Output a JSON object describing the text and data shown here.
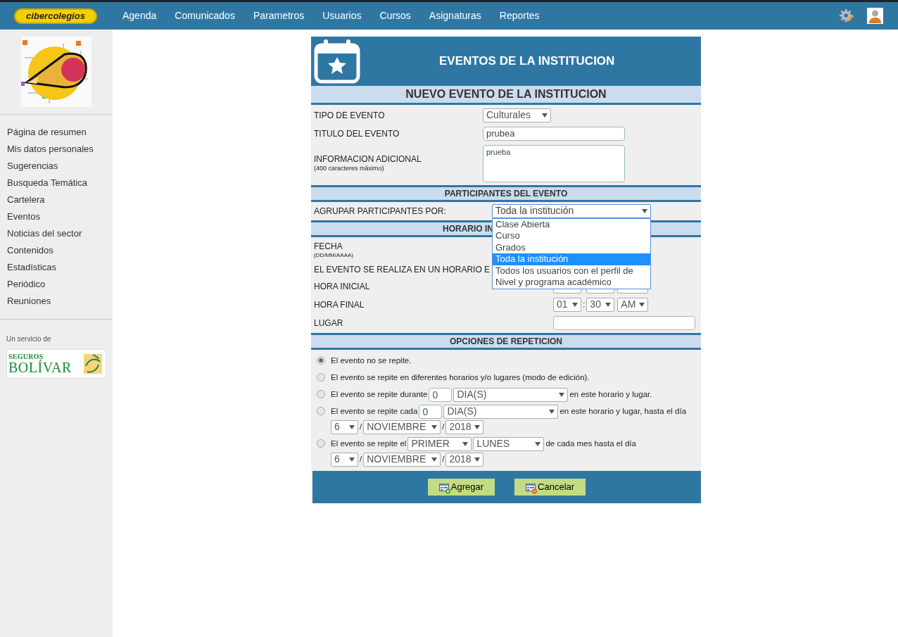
{
  "nav": {
    "logo": "cibercolegios",
    "items": [
      "Agenda",
      "Comunicados",
      "Parametros",
      "Usuarios",
      "Cursos",
      "Asignaturas",
      "Reportes"
    ]
  },
  "sidebar": {
    "items": [
      "Página de resumen",
      "Mis datos personales",
      "Sugerencias",
      "Busqueda Temática",
      "Cartelera",
      "Eventos",
      "Noticias del sector",
      "Contenidos",
      "Estadísticas",
      "Periódico",
      "Reuniones"
    ],
    "service_label": "Un servicio de",
    "sponsor": {
      "line1": "SEGUROS",
      "line2": "BOLÍVAR"
    }
  },
  "panel": {
    "title": "EVENTOS DE LA INSTITUCION",
    "form_title": "NUEVO EVENTO DE LA INSTITUCION",
    "fields": [
      {
        "kind": "select",
        "label": "TIPO DE EVENTO",
        "value": "Culturales"
      },
      {
        "kind": "text",
        "label": "TITULO DEL EVENTO",
        "value": "prubea"
      },
      {
        "kind": "textarea",
        "label": "INFORMACION ADICIONAL",
        "note": "(400 caracteres máximo)",
        "value": "prueba"
      }
    ]
  },
  "participants": {
    "title": "PARTICIPANTES DEL EVENTO",
    "label": "AGRUPAR PARTICIPANTES POR:",
    "select": {
      "value": "Toda la institución",
      "expanded": true,
      "options": [
        {
          "label": "Clase Abierta",
          "selected": false
        },
        {
          "label": "Curso",
          "selected": false
        },
        {
          "label": "Grados",
          "selected": false
        },
        {
          "label": "Toda la institución",
          "selected": true
        },
        {
          "label": "Todos los usuarios con el perfil de",
          "selected": false
        },
        {
          "label": "Nivel y programa académico",
          "selected": false
        }
      ]
    }
  },
  "schedule": {
    "title": "HORARIO IN",
    "rows": [
      {
        "kind": "date",
        "label": "FECHA",
        "note": "(DD/MM/AAAA)"
      },
      {
        "kind": "plain",
        "label": "EL EVENTO SE REALIZA EN UN HORARIO E"
      },
      {
        "kind": "time",
        "label": "HORA INICIAL"
      },
      {
        "kind": "time",
        "label": "HORA FINAL",
        "hour": "01",
        "separator": ":",
        "minute": "30",
        "period": "AM"
      },
      {
        "kind": "input",
        "label": "LUGAR"
      }
    ]
  },
  "repetition": {
    "title": "OPCIONES DE REPETICION",
    "options": [
      {
        "selected": true,
        "parts": [
          {
            "kind": "text",
            "text": "El evento no se repite."
          }
        ]
      },
      {
        "selected": false,
        "parts": [
          {
            "kind": "text",
            "text": "El evento se repite en diferentes horarios y/o lugares (modo de edición)."
          }
        ]
      },
      {
        "selected": false,
        "parts": [
          {
            "kind": "text",
            "text": "El evento se repite durante"
          },
          {
            "kind": "input",
            "value": "0"
          },
          {
            "kind": "unit",
            "value": "DIA(S)"
          },
          {
            "kind": "text",
            "text": "en este horario y lugar."
          }
        ]
      },
      {
        "selected": false,
        "parts": [
          {
            "kind": "text",
            "text": "El evento se repite cada"
          },
          {
            "kind": "input",
            "value": "0"
          },
          {
            "kind": "unit",
            "value": "DIA(S)"
          },
          {
            "kind": "text",
            "text": "en este horario y lugar, hasta el día"
          },
          {
            "kind": "break"
          },
          {
            "kind": "day",
            "value": "6"
          },
          {
            "kind": "sep",
            "text": "/"
          },
          {
            "kind": "month",
            "value": "NOVIEMBRE"
          },
          {
            "kind": "sep",
            "text": "/"
          },
          {
            "kind": "year",
            "value": "2018"
          }
        ]
      },
      {
        "selected": false,
        "parts": [
          {
            "kind": "text",
            "text": "El evento se repite el"
          },
          {
            "kind": "ordinal",
            "value": "PRIMER"
          },
          {
            "kind": "weekday",
            "value": "LUNES"
          },
          {
            "kind": "text",
            "text": "de cada mes hasta el día"
          },
          {
            "kind": "break"
          },
          {
            "kind": "day",
            "value": "6"
          },
          {
            "kind": "sep",
            "text": "/"
          },
          {
            "kind": "month",
            "value": "NOVIEMBRE"
          },
          {
            "kind": "sep",
            "text": "/"
          },
          {
            "kind": "year",
            "value": "2018"
          }
        ]
      }
    ]
  },
  "buttons": [
    {
      "kind": "add",
      "label": "Agregar"
    },
    {
      "kind": "cancel",
      "label": "Cancelar"
    }
  ]
}
